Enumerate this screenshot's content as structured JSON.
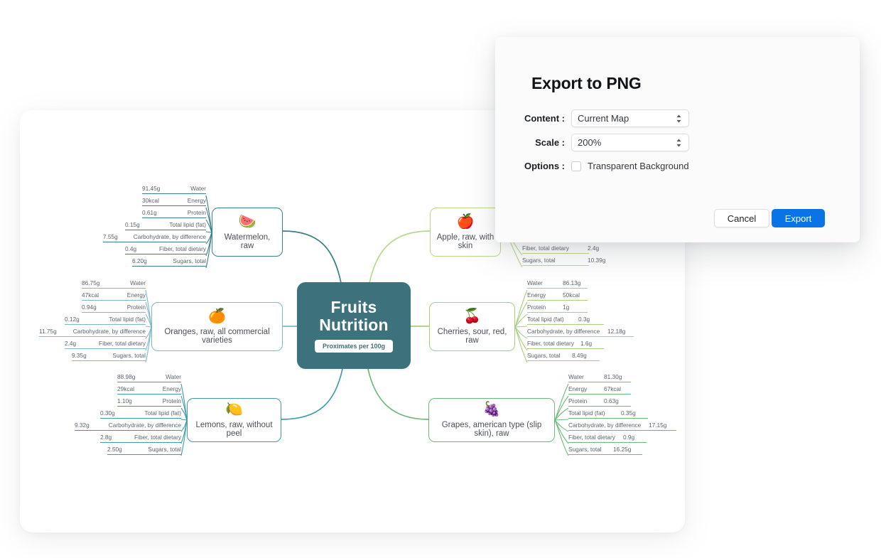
{
  "mindmap": {
    "center": {
      "title_line1": "Fruits",
      "title_line2": "Nutrition",
      "subtitle": "Proximates per 100g"
    },
    "topics": [
      {
        "id": "watermelon",
        "label": "Watermelon, raw",
        "icon": "watermelon-icon",
        "glyph": "🍉",
        "side": "left",
        "color": "#3d7f8a",
        "leaves": [
          {
            "value": "91.45g",
            "text": "Water"
          },
          {
            "value": "30kcal",
            "text": "Energy"
          },
          {
            "value": "0.61g",
            "text": "Protein"
          },
          {
            "value": "0.15g",
            "text": "Total lipid (fat)"
          },
          {
            "value": "7.55g",
            "text": "Carbohydrate, by difference"
          },
          {
            "value": "0.4g",
            "text": "Fiber, total dietary"
          },
          {
            "value": "6.20g",
            "text": "Sugars, total"
          }
        ]
      },
      {
        "id": "oranges",
        "label": "Oranges, raw, all commercial varieties",
        "icon": "orange-icon",
        "glyph": "🍊",
        "side": "left",
        "color": "#7fb8cc",
        "leaves": [
          {
            "value": "86.75g",
            "text": "Water"
          },
          {
            "value": "47kcal",
            "text": "Energy"
          },
          {
            "value": "0.94g",
            "text": "Protein"
          },
          {
            "value": "0.12g",
            "text": "Total lipid (fat)"
          },
          {
            "value": "11.75g",
            "text": "Carbohydrate, by difference"
          },
          {
            "value": "2.4g",
            "text": "Fiber, total dietary"
          },
          {
            "value": "9.35g",
            "text": "Sugars, total"
          }
        ]
      },
      {
        "id": "lemons",
        "label": "Lemons, raw, without peel",
        "icon": "lemon-icon",
        "glyph": "🍋",
        "side": "left",
        "color": "#3f9ea5",
        "leaves": [
          {
            "value": "88.98g",
            "text": "Water"
          },
          {
            "value": "29kcal",
            "text": "Energy"
          },
          {
            "value": "1.10g",
            "text": "Protein"
          },
          {
            "value": "0.30g",
            "text": "Total lipid (fat)"
          },
          {
            "value": "9.32g",
            "text": "Carbohydrate, by difference"
          },
          {
            "value": "2.8g",
            "text": "Fiber, total dietary"
          },
          {
            "value": "2.50g",
            "text": "Sugars, total"
          }
        ]
      },
      {
        "id": "apple",
        "label": "Apple, raw, with skin",
        "icon": "apple-icon",
        "glyph": "🍎",
        "side": "right",
        "color": "#b7d98a",
        "leaves": [
          {
            "value": "2.4g",
            "text": "Fiber, total dietary"
          },
          {
            "value": "10.39g",
            "text": "Sugars, total"
          }
        ]
      },
      {
        "id": "cherries",
        "label": "Cherries, sour, red, raw",
        "icon": "cherries-icon",
        "glyph": "🍒",
        "side": "right",
        "color": "#a6cf80",
        "leaves": [
          {
            "value": "86.13g",
            "text": "Water"
          },
          {
            "value": "50kcal",
            "text": "Energy"
          },
          {
            "value": "1g",
            "text": "Protein"
          },
          {
            "value": "0.3g",
            "text": "Total lipid (fat)"
          },
          {
            "value": "12.18g",
            "text": "Carbohydrate, by difference"
          },
          {
            "value": "1.6g",
            "text": "Fiber, total dietary"
          },
          {
            "value": "8.49g",
            "text": "Sugars, total"
          }
        ]
      },
      {
        "id": "grapes",
        "label": "Grapes, american type (slip skin), raw",
        "icon": "grapes-icon",
        "glyph": "🍇",
        "side": "right",
        "color": "#6cb97c",
        "leaves": [
          {
            "value": "81.30g",
            "text": "Water"
          },
          {
            "value": "67kcal",
            "text": "Energy"
          },
          {
            "value": "0.63g",
            "text": "Protein"
          },
          {
            "value": "0.35g",
            "text": "Total lipid (fat)"
          },
          {
            "value": "17.15g",
            "text": "Carbohydrate, by difference"
          },
          {
            "value": "0.9g",
            "text": "Fiber, total dietary"
          },
          {
            "value": "16.25g",
            "text": "Sugars, total"
          }
        ]
      }
    ]
  },
  "dialog": {
    "title": "Export to PNG",
    "content_label": "Content :",
    "content_value": "Current Map",
    "scale_label": "Scale :",
    "scale_value": "200%",
    "options_label": "Options :",
    "transparent_label": "Transparent Background",
    "transparent_checked": false,
    "cancel_label": "Cancel",
    "export_label": "Export",
    "accent_color": "#0a74e6"
  }
}
